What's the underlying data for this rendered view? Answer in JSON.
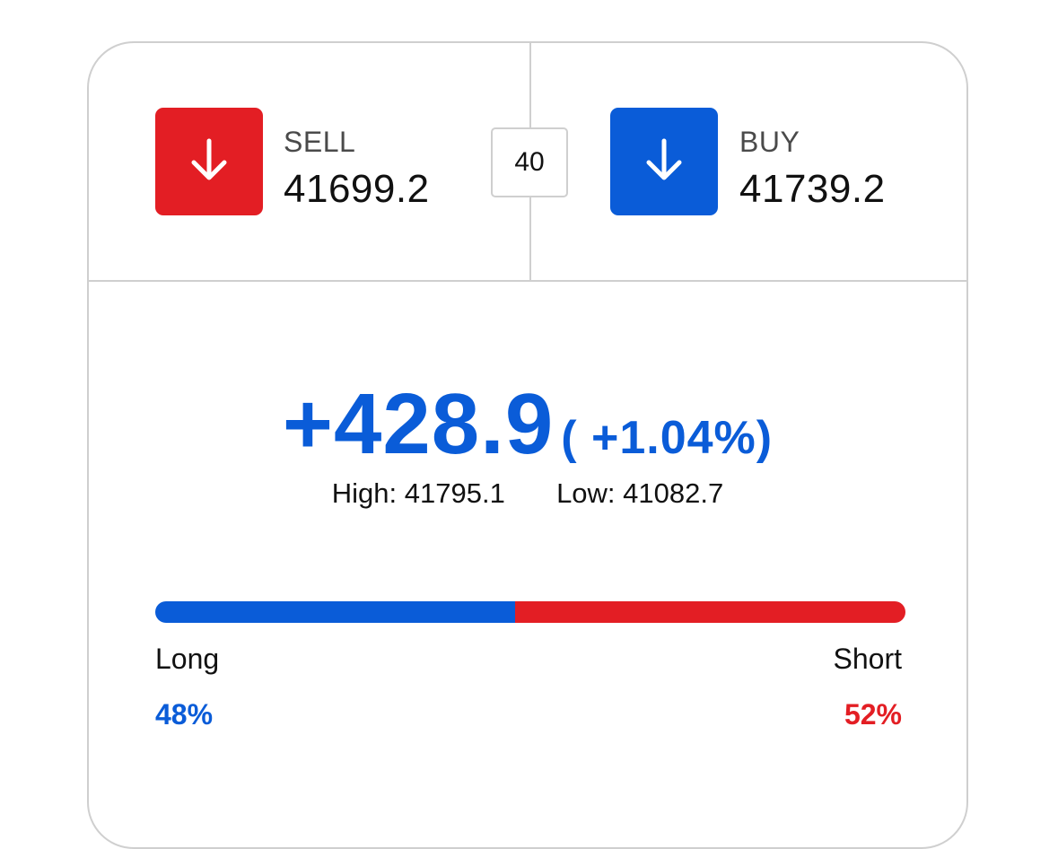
{
  "colors": {
    "sell": "#e31e24",
    "buy": "#0a5cd8",
    "border": "#cfcfcf"
  },
  "quote": {
    "sell": {
      "label": "SELL",
      "price": "41699.2",
      "icon": "arrow-down-icon"
    },
    "spread": "40",
    "buy": {
      "label": "BUY",
      "price": "41739.2",
      "icon": "arrow-down-icon"
    }
  },
  "change": {
    "absolute": "+428.9",
    "percent": "( +1.04%)"
  },
  "range": {
    "high_label": "High:",
    "high_value": "41795.1",
    "low_label": "Low:",
    "low_value": "41082.7"
  },
  "sentiment": {
    "long_label": "Long",
    "long_pct": "48%",
    "long_fraction": 0.48,
    "short_label": "Short",
    "short_pct": "52%",
    "short_fraction": 0.52
  }
}
